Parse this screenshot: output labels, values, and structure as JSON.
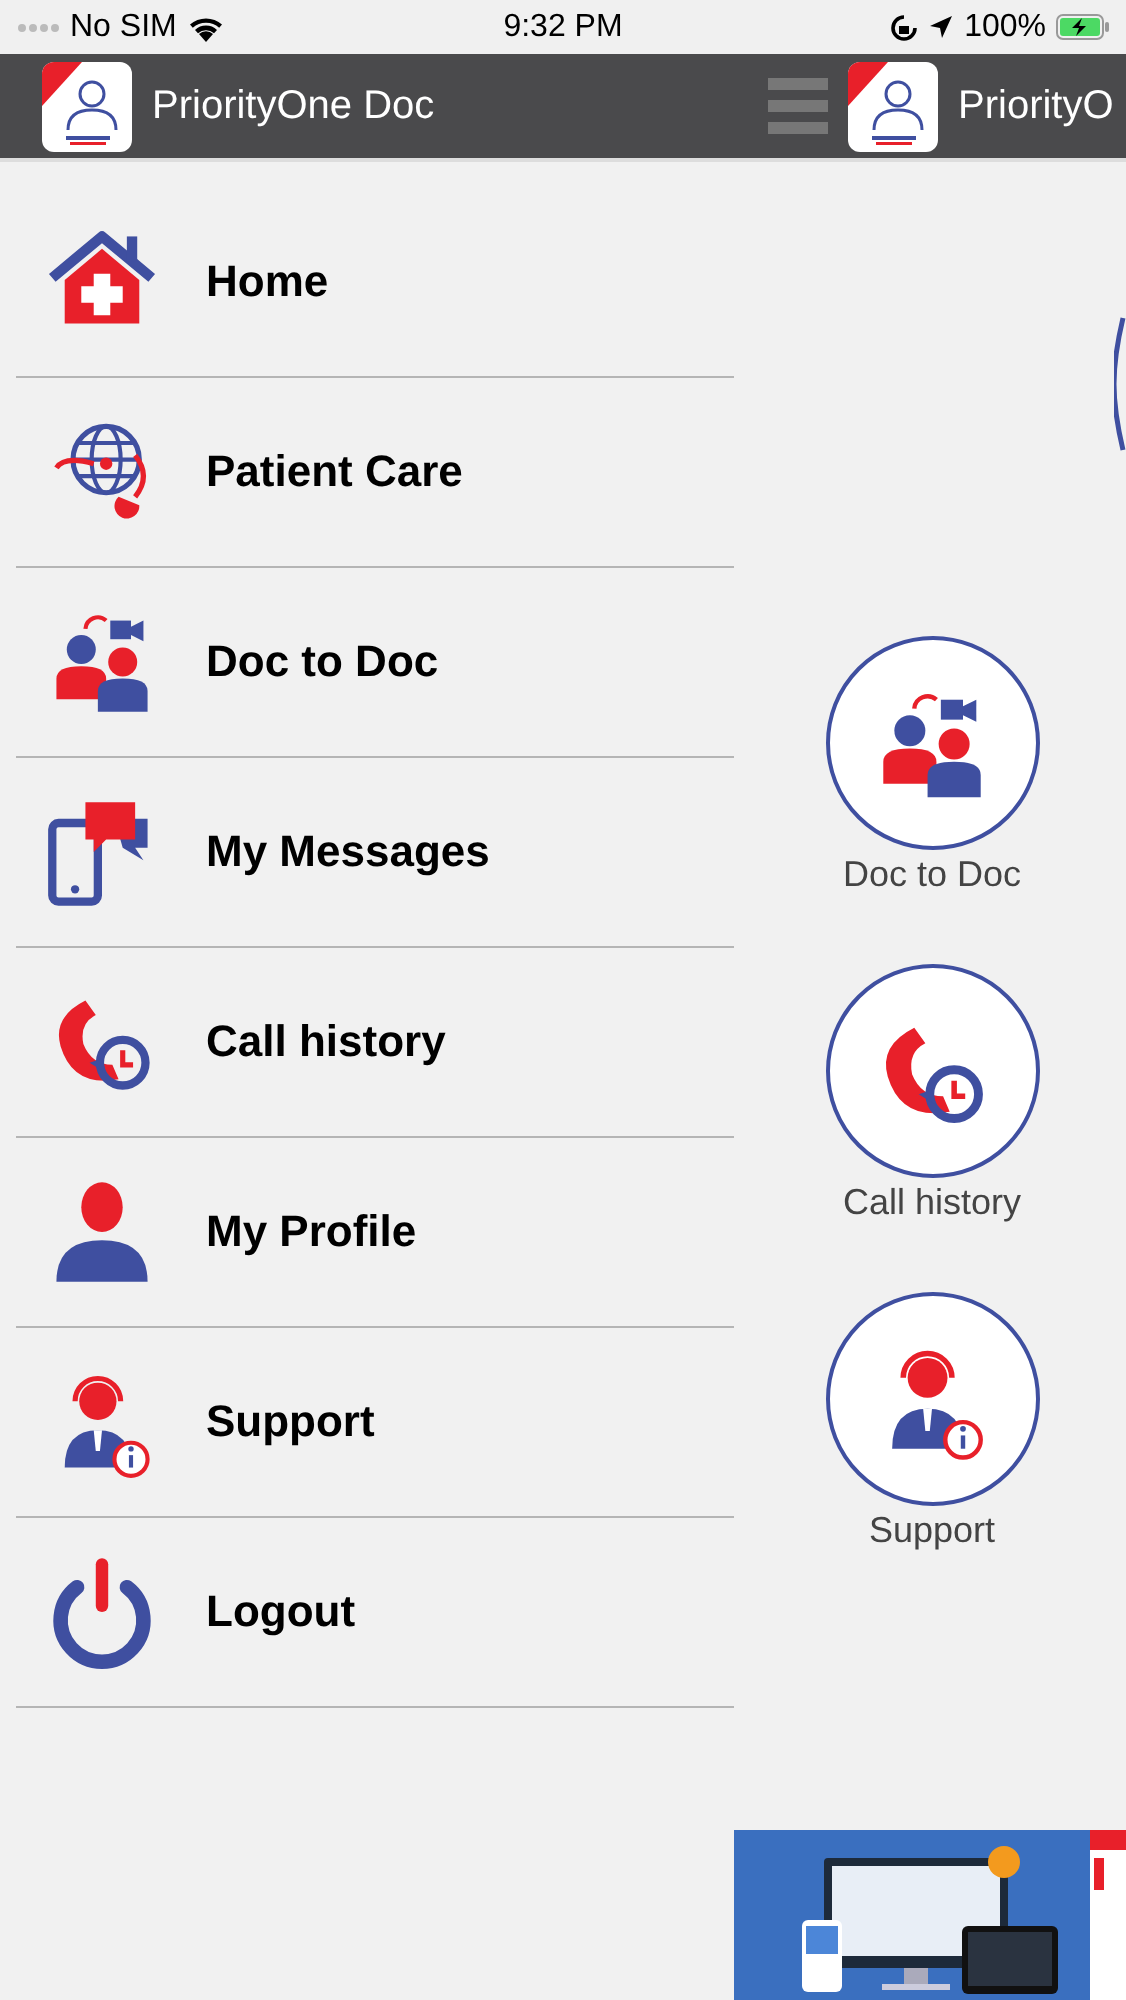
{
  "status_bar": {
    "carrier": "No SIM",
    "time": "9:32 PM",
    "battery": "100%"
  },
  "drawer": {
    "app_title": "PriorityOne Doc",
    "items": [
      {
        "label": "Home",
        "kind": "home"
      },
      {
        "label": "Patient Care",
        "kind": "globe"
      },
      {
        "label": "Doc to Doc",
        "kind": "doctors"
      },
      {
        "label": "My Messages",
        "kind": "messages"
      },
      {
        "label": "Call history",
        "kind": "call"
      },
      {
        "label": "My Profile",
        "kind": "profile"
      },
      {
        "label": "Support",
        "kind": "support"
      },
      {
        "label": "Logout",
        "kind": "logout"
      }
    ]
  },
  "main": {
    "app_title": "PriorityO",
    "tiles": [
      {
        "label": "Doc to Doc",
        "kind": "doctors"
      },
      {
        "label": "Call history",
        "kind": "call"
      },
      {
        "label": "Support",
        "kind": "support"
      }
    ]
  }
}
